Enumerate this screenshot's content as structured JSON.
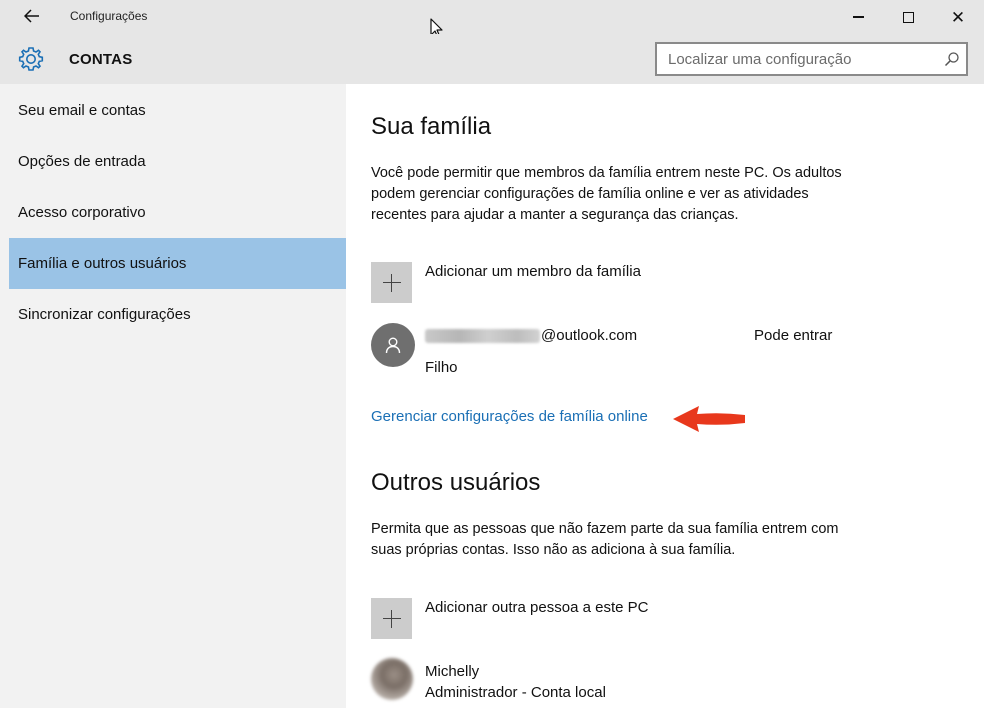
{
  "titlebar": {
    "app_title": "Configurações",
    "back_icon": "arrow-left-icon",
    "minimize_icon": "minimize-icon",
    "maximize_icon": "maximize-icon",
    "close_icon": "close-icon"
  },
  "header": {
    "section_title": "CONTAS",
    "icon": "gear-icon",
    "search_placeholder": "Localizar uma configuração",
    "accent_color": "#1a6fb5"
  },
  "sidebar": {
    "items": [
      {
        "label": "Seu email e contas",
        "active": false
      },
      {
        "label": "Opções de entrada",
        "active": false
      },
      {
        "label": "Acesso corporativo",
        "active": false
      },
      {
        "label": "Família e outros usuários",
        "active": true
      },
      {
        "label": "Sincronizar configurações",
        "active": false
      }
    ],
    "active_color": "#9ac3e6"
  },
  "family": {
    "heading": "Sua família",
    "description": "Você pode permitir que membros da família entrem neste PC. Os adultos podem gerenciar configurações de família online e ver as atividades recentes para ajudar a manter a segurança das crianças.",
    "add_label": "Adicionar um membro da família",
    "member": {
      "email_suffix": "@outlook.com",
      "status": "Pode entrar",
      "role": "Filho"
    },
    "manage_link": "Gerenciar configurações de família online",
    "annotation_color": "#e8381c"
  },
  "others": {
    "heading": "Outros usuários",
    "description": "Permita que as pessoas que não fazem parte da sua família entrem com suas próprias contas. Isso não as adiciona à sua família.",
    "add_label": "Adicionar outra pessoa a este PC",
    "user": {
      "name": "Michelly",
      "type": "Administrador - Conta local"
    }
  }
}
